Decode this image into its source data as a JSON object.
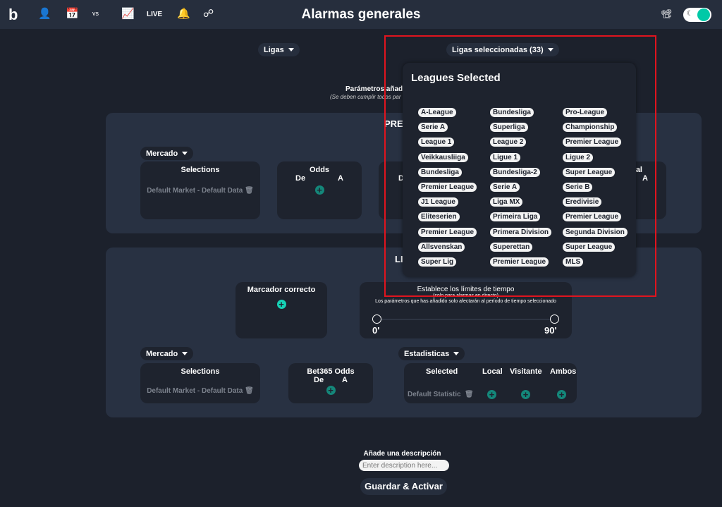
{
  "header": {
    "title": "Alarmas generales",
    "live_label": "LIVE",
    "icons": [
      "logo-b",
      "user-icon",
      "calendar-icon",
      "versus-icon",
      "chart-icon",
      "live",
      "bell-icon",
      "share-icon"
    ],
    "accent": "#00c9a7",
    "toggle_on": true
  },
  "filters": {
    "leagues_label": "Ligas",
    "selected_leagues_label": "Ligas seleccionadas (33)"
  },
  "params": {
    "title": "Parámetros añad",
    "subtitle": "(Se deben cumplir todos par"
  },
  "dropdown": {
    "title": "Leagues Selected",
    "columns": [
      [
        "A-League",
        "Serie A",
        "League 1",
        "Veikkausliiga",
        "Bundesliga",
        "Premier League",
        "J1 League",
        "Eliteserien",
        "Premier League",
        "Allsvenskan",
        "Super Lig"
      ],
      [
        "Bundesliga",
        "Superliga",
        "League 2",
        "Ligue 1",
        "Bundesliga-2",
        "Serie A",
        "Liga MX",
        "Primeira Liga",
        "Primera Division",
        "Superettan",
        "Premier League"
      ],
      [
        "Pro-League",
        "Championship",
        "Premier League",
        "Ligue 2",
        "Super League",
        "Serie B",
        "Eredivisie",
        "Premier League",
        "Segunda Division",
        "Super League",
        "MLS"
      ]
    ]
  },
  "pregame": {
    "title": "PREG",
    "market_label": "Mercado",
    "selections_title": "Selections",
    "selection_item": "Default Market - Default Data",
    "odds_title": "Odds",
    "from": "De",
    "to": "A",
    "partial_from": "D",
    "partial_title": "al"
  },
  "live": {
    "title": "LI",
    "correct_score": "Marcador correcto",
    "time_title": "Establece los límites de tiempo",
    "time_sub1": "(solo para alarmas en directo)",
    "time_sub2": "Los parámetros que has añadido solo afectarán al período de tiempo seleccionado",
    "time_min": "0'",
    "time_max": "90'",
    "market_label": "Mercado",
    "selections_title": "Selections",
    "selection_item": "Default Market - Default Data",
    "bet365_title": "Bet365 Odds",
    "from": "De",
    "to": "A",
    "stats_label": "Estadisticas",
    "stats_cols": [
      "Selected",
      "Local",
      "Visitante",
      "Ambos"
    ],
    "stats_item": "Default Statistic"
  },
  "footer": {
    "desc_label": "Añade una descripción",
    "desc_placeholder": "Enter description here...",
    "save_label": "Guardar & Activar"
  }
}
